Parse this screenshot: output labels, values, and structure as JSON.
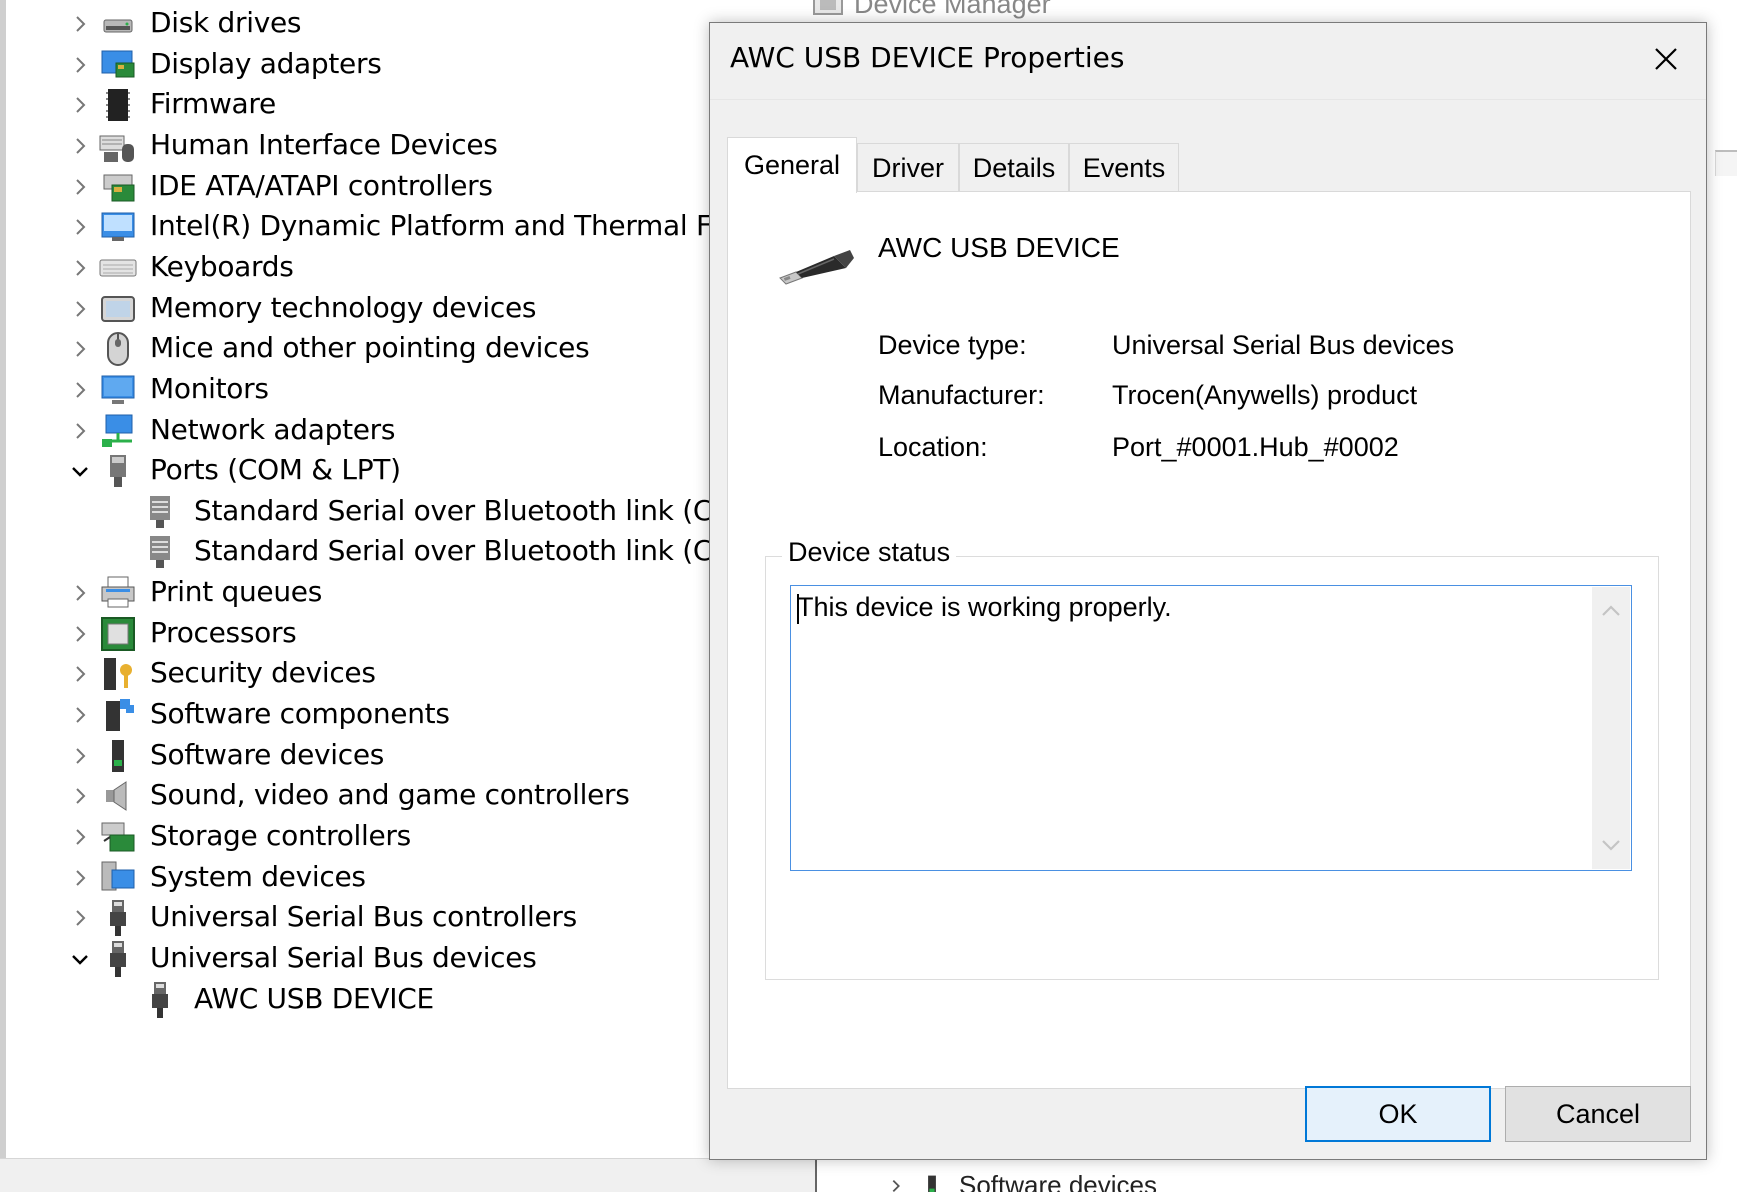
{
  "background_window": {
    "title": "Device Manager",
    "tree": [
      {
        "label": "Disk drives",
        "icon": "disk-drive-icon",
        "expanded": false,
        "level": 0
      },
      {
        "label": "Display adapters",
        "icon": "display-adapter-icon",
        "expanded": false,
        "level": 0
      },
      {
        "label": "Firmware",
        "icon": "firmware-icon",
        "expanded": false,
        "level": 0
      },
      {
        "label": "Human Interface Devices",
        "icon": "hid-icon",
        "expanded": false,
        "level": 0
      },
      {
        "label": "IDE ATA/ATAPI controllers",
        "icon": "ide-controller-icon",
        "expanded": false,
        "level": 0
      },
      {
        "label": "Intel(R) Dynamic Platform and Thermal Framework",
        "icon": "thermal-framework-icon",
        "expanded": false,
        "level": 0
      },
      {
        "label": "Keyboards",
        "icon": "keyboard-icon",
        "expanded": false,
        "level": 0
      },
      {
        "label": "Memory technology devices",
        "icon": "memory-device-icon",
        "expanded": false,
        "level": 0
      },
      {
        "label": "Mice and other pointing devices",
        "icon": "mouse-icon",
        "expanded": false,
        "level": 0
      },
      {
        "label": "Monitors",
        "icon": "monitor-icon",
        "expanded": false,
        "level": 0
      },
      {
        "label": "Network adapters",
        "icon": "network-adapter-icon",
        "expanded": false,
        "level": 0
      },
      {
        "label": "Ports (COM & LPT)",
        "icon": "port-icon",
        "expanded": true,
        "level": 0
      },
      {
        "label": "Standard Serial over Bluetooth link (COM",
        "icon": "serial-port-icon",
        "expanded": null,
        "level": 1
      },
      {
        "label": "Standard Serial over Bluetooth link (COM",
        "icon": "serial-port-icon",
        "expanded": null,
        "level": 1
      },
      {
        "label": "Print queues",
        "icon": "printer-icon",
        "expanded": false,
        "level": 0
      },
      {
        "label": "Processors",
        "icon": "processor-icon",
        "expanded": false,
        "level": 0
      },
      {
        "label": "Security devices",
        "icon": "security-device-icon",
        "expanded": false,
        "level": 0
      },
      {
        "label": "Software components",
        "icon": "software-component-icon",
        "expanded": false,
        "level": 0
      },
      {
        "label": "Software devices",
        "icon": "software-device-icon",
        "expanded": false,
        "level": 0
      },
      {
        "label": "Sound, video and game controllers",
        "icon": "sound-icon",
        "expanded": false,
        "level": 0
      },
      {
        "label": "Storage controllers",
        "icon": "storage-controller-icon",
        "expanded": false,
        "level": 0
      },
      {
        "label": "System devices",
        "icon": "system-device-icon",
        "expanded": false,
        "level": 0
      },
      {
        "label": "Universal Serial Bus controllers",
        "icon": "usb-controller-icon",
        "expanded": false,
        "level": 0
      },
      {
        "label": "Universal Serial Bus devices",
        "icon": "usb-device-icon",
        "expanded": true,
        "level": 0
      },
      {
        "label": "AWC USB DEVICE",
        "icon": "usb-device-icon",
        "expanded": null,
        "level": 1
      }
    ],
    "second_window_row": "Software devices"
  },
  "dialog": {
    "title": "AWC USB DEVICE Properties",
    "tabs": [
      {
        "label": "General",
        "active": true
      },
      {
        "label": "Driver",
        "active": false
      },
      {
        "label": "Details",
        "active": false
      },
      {
        "label": "Events",
        "active": false
      }
    ],
    "device_name": "AWC USB DEVICE",
    "properties": [
      {
        "label": "Device type:",
        "value": "Universal Serial Bus devices"
      },
      {
        "label": "Manufacturer:",
        "value": "Trocen(Anywells) product"
      },
      {
        "label": "Location:",
        "value": "Port_#0001.Hub_#0002"
      }
    ],
    "status_group_label": "Device status",
    "status_text": "This device is working properly.",
    "ok_label": "OK",
    "cancel_label": "Cancel"
  },
  "colors": {
    "accent": "#0078d7",
    "focus_border": "#4a90e2"
  }
}
